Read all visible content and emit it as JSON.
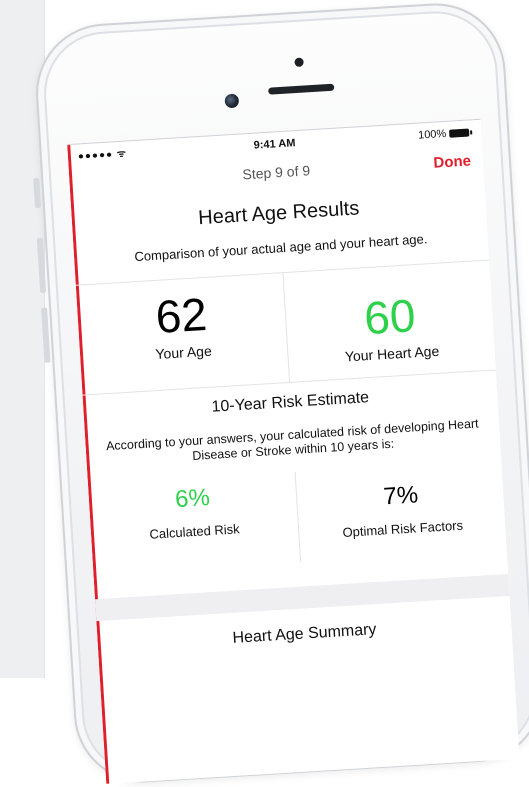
{
  "colors": {
    "accent": "#e01f2c",
    "positive": "#2dd14a"
  },
  "status_bar": {
    "signal": "●●●●● ᯤ",
    "time": "9:41 AM",
    "battery": "100%"
  },
  "nav": {
    "step": "Step 9 of 9",
    "done_label": "Done"
  },
  "results": {
    "title": "Heart Age Results",
    "subtitle": "Comparison of your actual age and your heart age.",
    "your_age": {
      "value": "62",
      "label": "Your Age"
    },
    "heart_age": {
      "value": "60",
      "label": "Your Heart Age"
    }
  },
  "risk": {
    "title": "10-Year Risk Estimate",
    "description": "According to your answers, your calculated risk of developing Heart Disease or Stroke within 10 years is:",
    "calculated": {
      "value": "6%",
      "label": "Calculated Risk"
    },
    "optimal": {
      "value": "7%",
      "label": "Optimal Risk Factors"
    }
  },
  "summary": {
    "title": "Heart Age Summary"
  }
}
